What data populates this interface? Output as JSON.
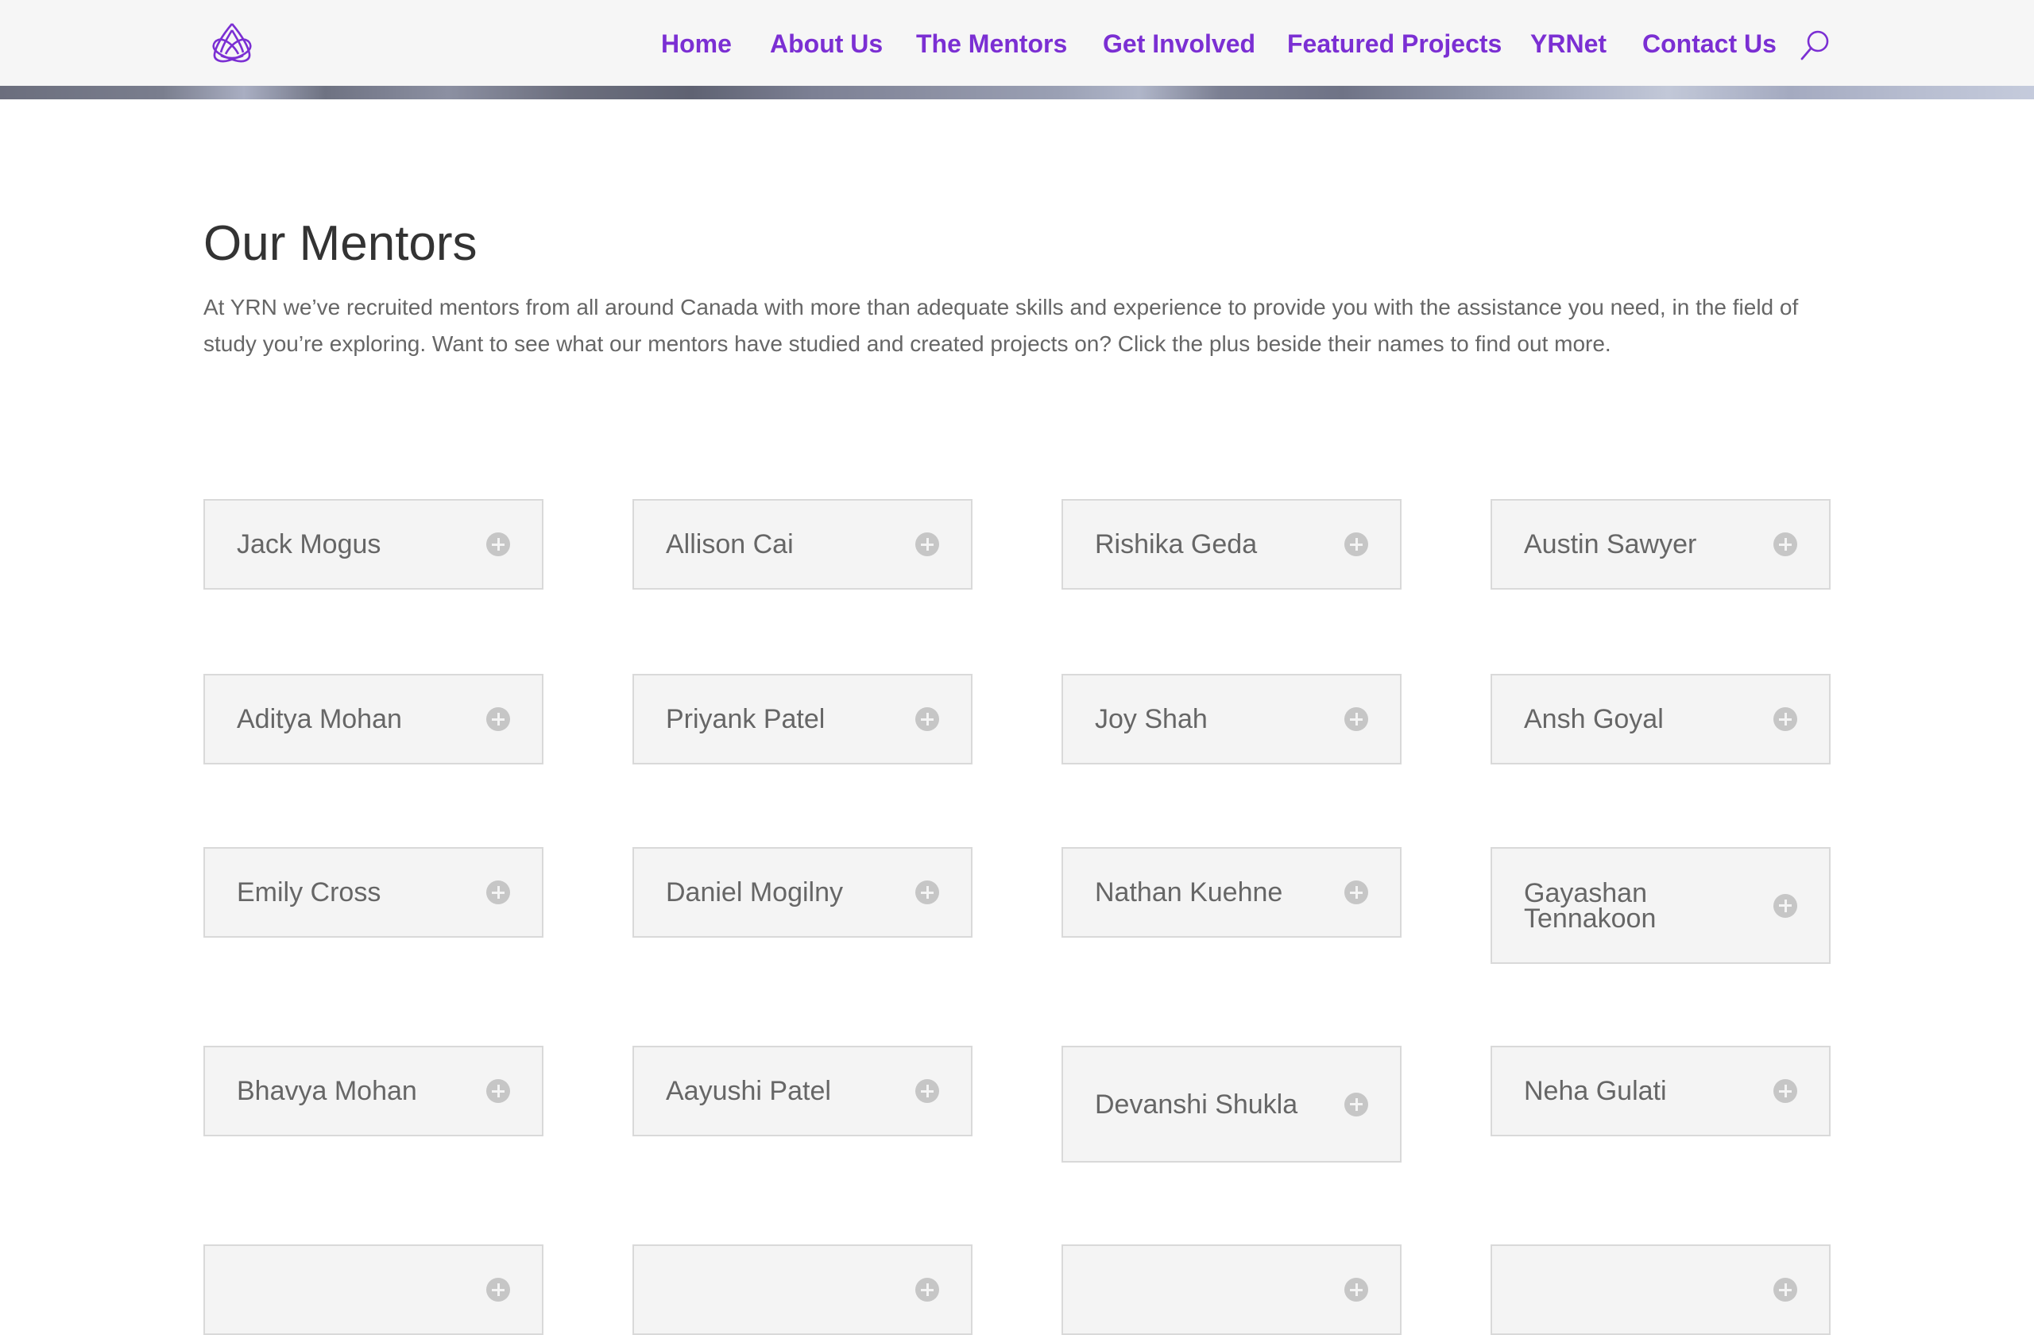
{
  "header": {
    "logo_icon": "yrn-knot-logo-icon",
    "brand_color": "#7b2fd3",
    "nav": [
      {
        "label": "Home"
      },
      {
        "label": "About Us"
      },
      {
        "label": "The Mentors"
      },
      {
        "label": "Get Involved"
      },
      {
        "label": "Featured Projects"
      },
      {
        "label": "YRNet"
      },
      {
        "label": "Contact Us"
      }
    ],
    "search_icon": "search-icon"
  },
  "main": {
    "title": "Our Mentors",
    "intro": "At YRN we’ve recruited mentors from all around Canada with more than adequate skills and experience to provide you with the assistance you need, in the field of study you’re exploring. Want to see what our mentors have studied and created projects on? Click the plus beside their names to find out more."
  },
  "mentors": [
    {
      "name": "Jack Mogus"
    },
    {
      "name": "Allison Cai"
    },
    {
      "name": "Rishika Geda"
    },
    {
      "name": "Austin Sawyer"
    },
    {
      "name": "Aditya Mohan"
    },
    {
      "name": "Priyank Patel"
    },
    {
      "name": "Joy Shah"
    },
    {
      "name": "Ansh Goyal"
    },
    {
      "name": "Emily Cross"
    },
    {
      "name": "Daniel Mogilny"
    },
    {
      "name": "Nathan Kuehne"
    },
    {
      "name": "Gayashan Tennakoon"
    },
    {
      "name": "Bhavya Mohan"
    },
    {
      "name": "Aayushi Patel"
    },
    {
      "name": "Devanshi Shukla"
    },
    {
      "name": "Neha Gulati"
    },
    {
      "name": ""
    },
    {
      "name": ""
    },
    {
      "name": ""
    },
    {
      "name": ""
    }
  ],
  "toggle_icon": "plus-circle-icon"
}
